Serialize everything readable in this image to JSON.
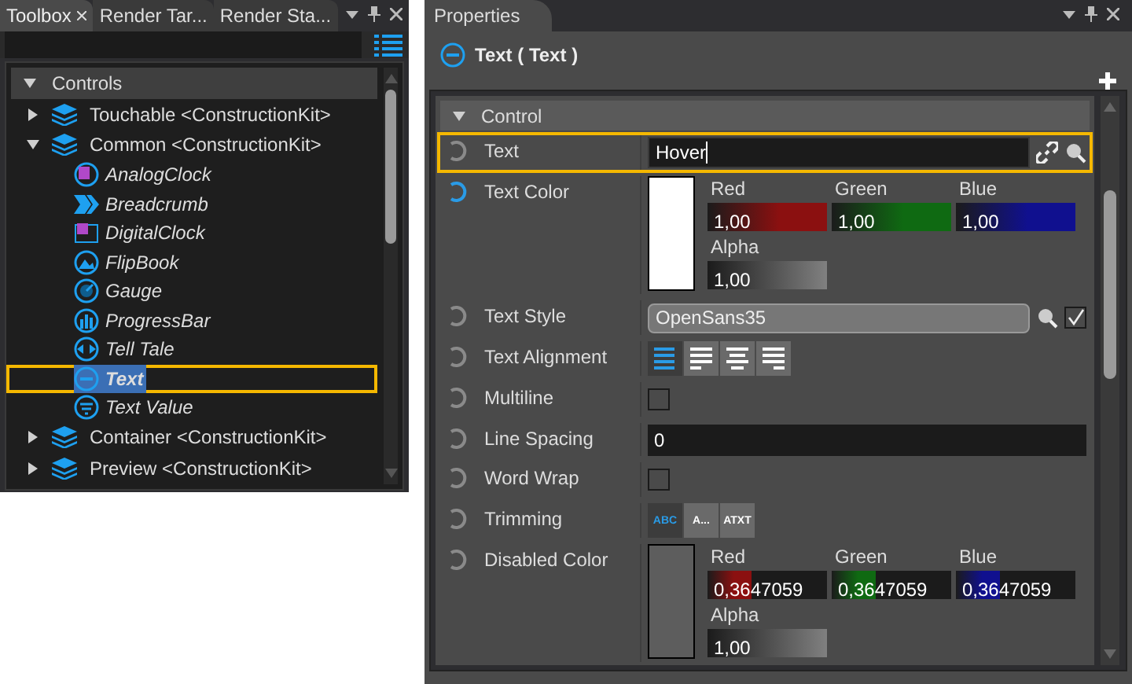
{
  "toolbox": {
    "tabs": [
      {
        "label": "Toolbox",
        "selected": true,
        "closable": true
      },
      {
        "label": "Render Tar...",
        "selected": false,
        "closable": false
      },
      {
        "label": "Render Sta...",
        "selected": false,
        "closable": false
      }
    ],
    "tree": {
      "label": "Controls",
      "expanded": true,
      "children": [
        {
          "label": "Touchable <ConstructionKit>",
          "expanded": false
        },
        {
          "label": "Common <ConstructionKit>",
          "expanded": true,
          "children": [
            {
              "label": "AnalogClock",
              "kind": "clock",
              "selected": false,
              "highlighted": false
            },
            {
              "label": "Breadcrumb",
              "kind": "breadcrumb",
              "selected": false,
              "highlighted": false
            },
            {
              "label": "DigitalClock",
              "kind": "digital",
              "selected": false,
              "highlighted": false
            },
            {
              "label": "FlipBook",
              "kind": "flipbook",
              "selected": false,
              "highlighted": false
            },
            {
              "label": "Gauge",
              "kind": "gauge",
              "selected": false,
              "highlighted": false
            },
            {
              "label": "ProgressBar",
              "kind": "progress",
              "selected": false,
              "highlighted": false
            },
            {
              "label": "Tell Tale",
              "kind": "telltale",
              "selected": false,
              "highlighted": false
            },
            {
              "label": "Text",
              "kind": "text",
              "selected": true,
              "highlighted": true
            },
            {
              "label": "Text Value",
              "kind": "textvalue",
              "selected": false,
              "highlighted": false
            }
          ]
        },
        {
          "label": "Container <ConstructionKit>",
          "expanded": false
        },
        {
          "label": "Preview <ConstructionKit>",
          "expanded": false
        }
      ]
    }
  },
  "properties": {
    "tab": "Properties",
    "heading": "Text ( Text )",
    "section": {
      "label": "Control",
      "expanded": true
    },
    "rows": [
      {
        "kind": "text",
        "label": "Text",
        "modified": false,
        "highlighted": true,
        "value": "Hover"
      },
      {
        "kind": "color",
        "label": "Text Color",
        "modified": true,
        "highlighted": false,
        "color": "#ffffff",
        "channels": [
          {
            "label": "Red",
            "value": "1,00",
            "color": "#8b1010",
            "level": 1
          },
          {
            "label": "Green",
            "value": "1,00",
            "color": "#0f6a12",
            "level": 1
          },
          {
            "label": "Blue",
            "value": "1,00",
            "color": "#10108f",
            "level": 1
          }
        ],
        "alpha": {
          "label": "Alpha",
          "value": "1,00",
          "level": 1
        }
      },
      {
        "kind": "style",
        "label": "Text Style",
        "modified": false,
        "highlighted": false,
        "value": "OpenSans35",
        "checked": true
      },
      {
        "kind": "alignment",
        "label": "Text Alignment",
        "modified": false,
        "highlighted": false,
        "options": [
          {
            "selected": true
          },
          {
            "selected": false
          },
          {
            "selected": false
          },
          {
            "selected": false
          }
        ]
      },
      {
        "kind": "checkbox",
        "label": "Multiline",
        "modified": false,
        "highlighted": false,
        "checked": false
      },
      {
        "kind": "number",
        "label": "Line Spacing",
        "modified": false,
        "highlighted": false,
        "value": "0"
      },
      {
        "kind": "checkbox",
        "label": "Word Wrap",
        "modified": false,
        "highlighted": false,
        "checked": false
      },
      {
        "kind": "trimming",
        "label": "Trimming",
        "modified": false,
        "highlighted": false,
        "options": [
          {
            "label": "ABC",
            "selected": true
          },
          {
            "label": "A...",
            "selected": false
          },
          {
            "label": "ATXT",
            "selected": false
          }
        ]
      },
      {
        "kind": "color",
        "label": "Disabled Color",
        "modified": false,
        "highlighted": false,
        "color": "#5d5d5d",
        "channels": [
          {
            "label": "Red",
            "value": "0,3647059",
            "color": "#8b1010",
            "level": 0.3647059
          },
          {
            "label": "Green",
            "value": "0,3647059",
            "color": "#0f6a12",
            "level": 0.3647059
          },
          {
            "label": "Blue",
            "value": "0,3647059",
            "color": "#10108f",
            "level": 0.3647059
          }
        ],
        "alpha": {
          "label": "Alpha",
          "value": "1,00",
          "level": 1
        }
      }
    ]
  }
}
